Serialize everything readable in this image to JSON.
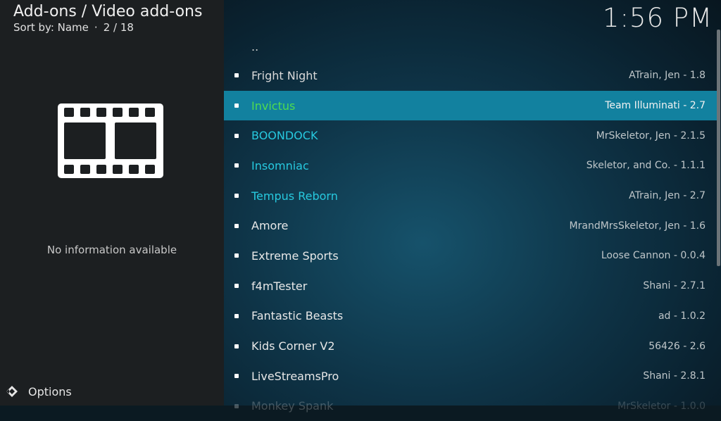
{
  "header": {
    "title": "Add-ons / Video add-ons",
    "sort_label": "Sort by: Name",
    "position": "2 / 18",
    "separator": "·"
  },
  "clock": "1:56 PM",
  "info": {
    "no_info_text": "No information available",
    "icon": "film-strip-icon"
  },
  "footer": {
    "options_label": "Options",
    "options_icon": "diamond-arrows-icon"
  },
  "colors": {
    "selected_row": "#12819f",
    "green": "#4fdc4f",
    "cyan": "#27c9df"
  },
  "list": {
    "parent_label": "..",
    "items": [
      {
        "name": "Fright Night",
        "author": "ATrain, Jen - 1.8",
        "name_color": "#d9d9d9"
      },
      {
        "name": "Invictus",
        "author": "Team Illuminati - 2.7",
        "name_color": "#4fdc4f"
      },
      {
        "name": "BOONDOCK",
        "author": "MrSkeletor, Jen - 2.1.5",
        "name_color": "#27c9df"
      },
      {
        "name": "Insomniac",
        "author": "Skeletor, and Co. - 1.1.1",
        "name_color": "#27c9df"
      },
      {
        "name": "Tempus Reborn",
        "author": "ATrain, Jen - 2.7",
        "name_color": "#27c9df"
      },
      {
        "name": "Amore",
        "author": "MrandMrsSkeletor, Jen - 1.6",
        "name_color": "#e8e8e8"
      },
      {
        "name": "Extreme Sports",
        "author": "Loose Cannon - 0.0.4",
        "name_color": "#e8e8e8"
      },
      {
        "name": "f4mTester",
        "author": "Shani - 2.7.1",
        "name_color": "#e8e8e8"
      },
      {
        "name": "Fantastic Beasts",
        "author": "ad - 1.0.2",
        "name_color": "#e8e8e8"
      },
      {
        "name": "Kids Corner V2",
        "author": "56426 - 2.6",
        "name_color": "#e8e8e8"
      },
      {
        "name": "LiveStreamsPro",
        "author": "Shani - 2.8.1",
        "name_color": "#e8e8e8"
      },
      {
        "name": "Monkey Spank",
        "author": "MrSkeletor - 1.0.0",
        "name_color": "#e8e8e8"
      }
    ]
  }
}
